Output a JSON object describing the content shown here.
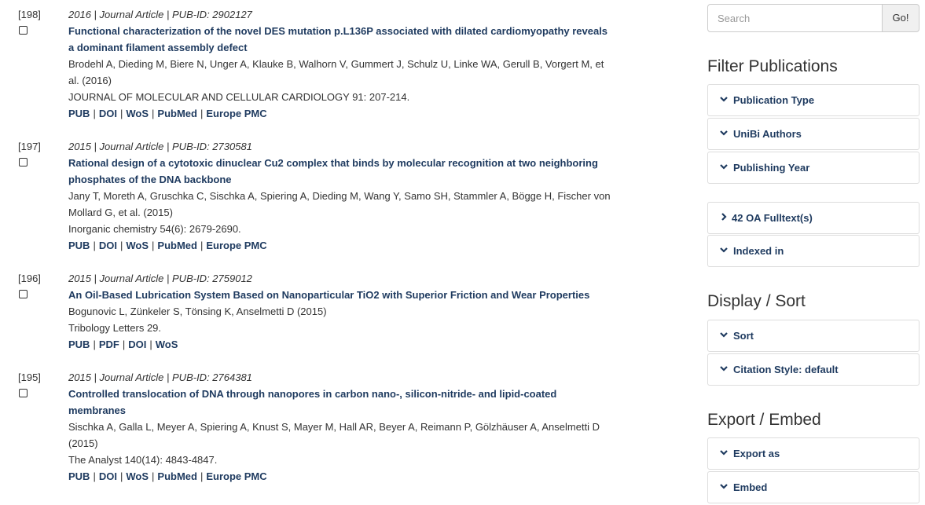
{
  "results": [
    {
      "index": "[198]",
      "meta": "2016 | Journal Article | PUB-ID: 2902127",
      "title": "Functional characterization of the novel DES mutation p.L136P associated with dilated cardiomyopathy reveals a dominant filament assembly defect",
      "authors": "Brodehl A, Dieding M, Biere N, Unger A, Klauke B, Walhorn V, Gummert J, Schulz U, Linke WA, Gerull B, Vorgert M, et al. (2016)",
      "journal": "JOURNAL OF MOLECULAR AND CELLULAR CARDIOLOGY 91: 207-214.",
      "links": [
        "PUB",
        "DOI",
        "WoS",
        "PubMed",
        "Europe PMC"
      ]
    },
    {
      "index": "[197]",
      "meta": "2015 | Journal Article | PUB-ID: 2730581",
      "title": "Rational design of a cytotoxic dinuclear Cu2 complex that binds by molecular recognition at two neighboring phosphates of the DNA backbone",
      "authors": "Jany T, Moreth A, Gruschka C, Sischka A, Spiering A, Dieding M, Wang Y, Samo SH, Stammler A, Bögge H, Fischer von Mollard G, et al. (2015)",
      "journal": "Inorganic chemistry 54(6): 2679-2690.",
      "links": [
        "PUB",
        "DOI",
        "WoS",
        "PubMed",
        "Europe PMC"
      ]
    },
    {
      "index": "[196]",
      "meta": "2015 | Journal Article | PUB-ID: 2759012",
      "title": "An Oil-Based Lubrication System Based on Nanoparticular TiO2 with Superior Friction and Wear Properties",
      "authors": "Bogunovic L, Zünkeler S, Tönsing K, Anselmetti D (2015)",
      "journal": "Tribology Letters 29.",
      "links": [
        "PUB",
        "PDF",
        "DOI",
        "WoS"
      ]
    },
    {
      "index": "[195]",
      "meta": "2015 | Journal Article | PUB-ID: 2764381",
      "title": "Controlled translocation of DNA through nanopores in carbon nano-, silicon-nitride- and lipid-coated membranes",
      "authors": "Sischka A, Galla L, Meyer A, Spiering A, Knust S, Mayer M, Hall AR, Beyer A, Reimann P, Gölzhäuser A, Anselmetti D (2015)",
      "journal": "The Analyst 140(14): 4843-4847.",
      "links": [
        "PUB",
        "DOI",
        "WoS",
        "PubMed",
        "Europe PMC"
      ]
    }
  ],
  "search": {
    "placeholder": "Search",
    "button": "Go!"
  },
  "filter": {
    "heading": "Filter Publications",
    "panels": [
      "Publication Type",
      "UniBi Authors",
      "Publishing Year"
    ],
    "oa": "42 OA Fulltext(s)",
    "indexed": "Indexed in"
  },
  "display": {
    "heading": "Display / Sort",
    "panels": [
      "Sort",
      "Citation Style: default"
    ]
  },
  "export": {
    "heading": "Export / Embed",
    "panels": [
      "Export as",
      "Embed"
    ]
  },
  "colors": {
    "link": "#1e3a5f",
    "text": "#333333",
    "border": "#dddddd"
  },
  "icons": {
    "expanded": "chevron-down-icon",
    "collapsed": "chevron-right-icon"
  }
}
